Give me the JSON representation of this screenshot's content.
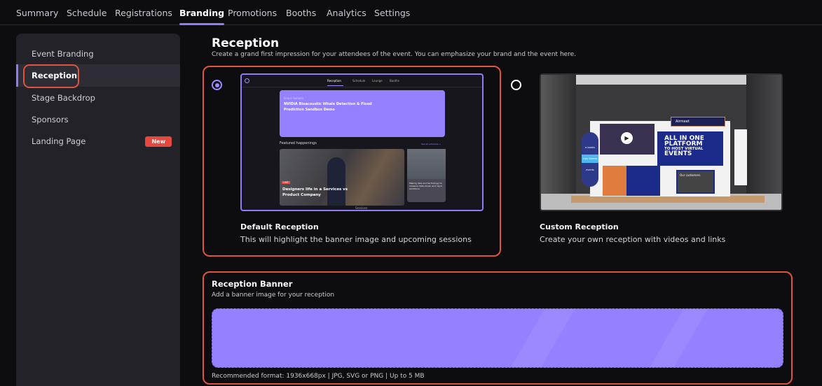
{
  "tabs": [
    "Summary",
    "Schedule",
    "Registrations",
    "Branding",
    "Promotions",
    "Booths",
    "Analytics",
    "Settings"
  ],
  "active_tab": "Branding",
  "sidebar": {
    "items": [
      {
        "label": "Event Branding"
      },
      {
        "label": "Reception"
      },
      {
        "label": "Stage Backdrop"
      },
      {
        "label": "Sponsors"
      },
      {
        "label": "Landing Page",
        "badge": "New"
      }
    ],
    "active": "Reception"
  },
  "reception": {
    "title": "Reception",
    "subtitle": "Create a grand first impression for your attendees of the event. You can emphasize your brand and the event here.",
    "options": [
      {
        "label": "Default Reception",
        "description": "This will highlight the banner image and upcoming sessions",
        "selected": true,
        "preview": {
          "nav": [
            "Reception",
            "Schedule",
            "Lounge",
            "Booths"
          ],
          "banner_kicker": "Grace Somers",
          "banner_title": "NVIDIA Bioacoustic Whale Detection & Flood Prediction Sandbox Demo",
          "featured": "Featured happenings",
          "see_all": "See all schedule >",
          "live": "LIVE",
          "session": "Designers life in a Services vs Product Company",
          "side_session": "Making data and technology to measure data-driven and nig in workforce",
          "footer": "Sessions"
        }
      },
      {
        "label": "Custom Reception",
        "description": "Create your own reception with videos and links",
        "selected": false,
        "preview": {
          "brand": "Airmeet",
          "headline": [
            "ALL IN ONE",
            "PLATFORM",
            "TO HOST VIRTUAL",
            "EVENTS"
          ],
          "stand": [
            "e-books",
            "Live Games",
            "events"
          ],
          "poster": "Our customers"
        }
      }
    ]
  },
  "banner": {
    "title": "Reception Banner",
    "subtitle": "Add a banner image for your reception",
    "hint": "Recommended format: 1936x668px | JPG, SVG or PNG | Up to 5 MB",
    "color": "#9580ff"
  },
  "colors": {
    "accent": "#8f7cf7",
    "highlight": "#e0533f",
    "badge": "#e5483f"
  }
}
